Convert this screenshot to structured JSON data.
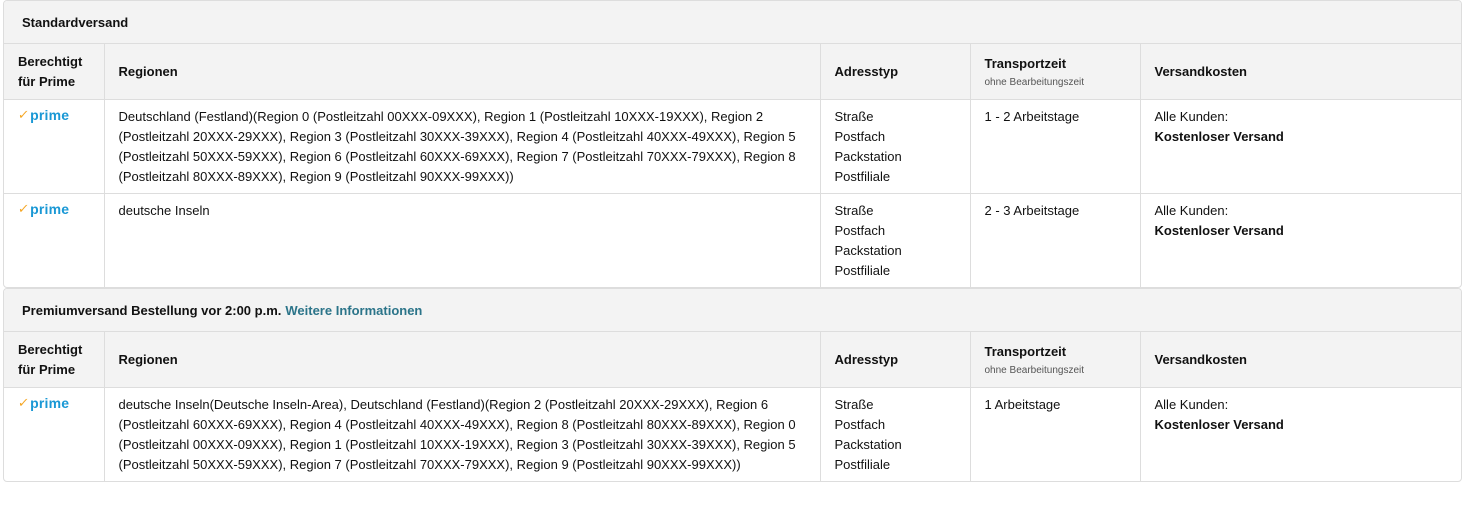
{
  "prime": {
    "brand_text": "prime",
    "check_glyph": "✓",
    "icon": "prime-logo-icon",
    "brand_color": "#1a98d5",
    "check_color": "#f5a623"
  },
  "headers": {
    "eligible": "Berechtigt für Prime",
    "regions": "Regionen",
    "address_type": "Adresstyp",
    "transport_time": "Transportzeit",
    "transport_time_note": "ohne Bearbeitungszeit",
    "shipping_cost": "Versandkosten"
  },
  "sections": [
    {
      "title": "Standardversand",
      "link": "",
      "rows": [
        {
          "regions": "Deutschland (Festland)(Region 0 (Postleitzahl 00XXX-09XXX), Region 1 (Postleitzahl 10XXX-19XXX), Region 2 (Postleitzahl 20XXX-29XXX), Region 3 (Postleitzahl 30XXX-39XXX), Region 4 (Postleitzahl 40XXX-49XXX), Region 5 (Postleitzahl 50XXX-59XXX), Region 6 (Postleitzahl 60XXX-69XXX), Region 7 (Postleitzahl 70XXX-79XXX), Region 8 (Postleitzahl 80XXX-89XXX), Region 9 (Postleitzahl 90XXX-99XXX))",
          "address_types": [
            "Straße",
            "Postfach",
            "Packstation",
            "Postfiliale"
          ],
          "transport": "1 - 2 Arbeitstage",
          "cost_label": "Alle Kunden:",
          "cost_value": "Kostenloser Versand"
        },
        {
          "regions": "deutsche Inseln",
          "address_types": [
            "Straße",
            "Postfach",
            "Packstation",
            "Postfiliale"
          ],
          "transport": "2 - 3 Arbeitstage",
          "cost_label": "Alle Kunden:",
          "cost_value": "Kostenloser Versand"
        }
      ]
    },
    {
      "title": "Premiumversand Bestellung vor 2:00 p.m.",
      "link": "Weitere Informationen",
      "rows": [
        {
          "regions": "deutsche Inseln(Deutsche Inseln-Area), Deutschland (Festland)(Region 2 (Postleitzahl 20XXX-29XXX), Region 6 (Postleitzahl 60XXX-69XXX), Region 4 (Postleitzahl 40XXX-49XXX), Region 8 (Postleitzahl 80XXX-89XXX), Region 0 (Postleitzahl 00XXX-09XXX), Region 1 (Postleitzahl 10XXX-19XXX), Region 3 (Postleitzahl 30XXX-39XXX), Region 5 (Postleitzahl 50XXX-59XXX), Region 7 (Postleitzahl 70XXX-79XXX), Region 9 (Postleitzahl 90XXX-99XXX))",
          "address_types": [
            "Straße",
            "Postfach",
            "Packstation",
            "Postfiliale"
          ],
          "transport": "1 Arbeitstage",
          "cost_label": "Alle Kunden:",
          "cost_value": "Kostenloser Versand"
        }
      ]
    }
  ]
}
